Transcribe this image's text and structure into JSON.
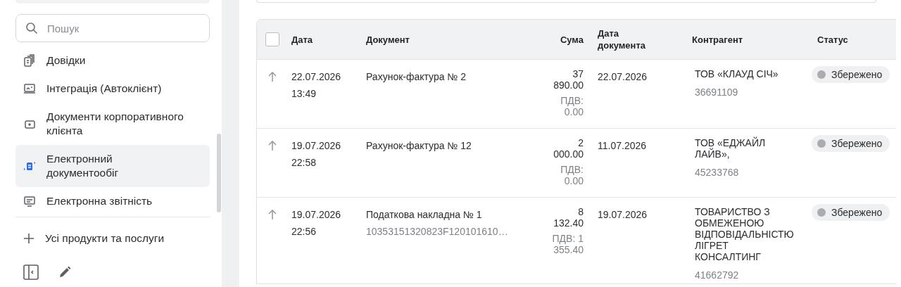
{
  "sidebar": {
    "search": {
      "placeholder": "Пошук"
    },
    "items": [
      {
        "label": "Довідки",
        "selected": false
      },
      {
        "label": "Інтеграція (Автоклієнт)",
        "selected": false
      },
      {
        "label": "Документи корпоративного клієнта",
        "selected": false
      },
      {
        "label": "Електронний документообіг",
        "selected": true
      },
      {
        "label": "Електронна звітність",
        "selected": false
      }
    ],
    "all_products": "Усі продукти та послуги"
  },
  "table": {
    "select_all": {
      "checked": false
    },
    "columns": [
      "Дата",
      "Документ",
      "Сума",
      "Дата документа",
      "Контрагент",
      "Статус"
    ],
    "rows": [
      {
        "date": "22.07.2026",
        "time": "13:49",
        "document": "Рахунок-фактура № 2",
        "amount": "37 890.00",
        "vat": "ПДВ: 0.00",
        "doc_date": "22.07.2026",
        "counterparty": "ТОВ «КЛАУД СІЧ»",
        "code": "36691109",
        "status": "Збережено"
      },
      {
        "date": "19.07.2026",
        "time": "22:58",
        "document": "Рахунок-фактура № 12",
        "amount": "2 000.00",
        "vat": "ПДВ: 0.00",
        "doc_date": "11.07.2026",
        "counterparty": "ТОВ «ЕДЖАЙЛ ЛАЙВ»,",
        "code": "45233768",
        "status": "Збережено"
      },
      {
        "date": "19.07.2026",
        "time": "22:56",
        "document": "Податкова накладна № 1",
        "doc_number": "10353151320823F120101610…",
        "amount": "8 132.40",
        "vat": "ПДВ: 1 355.40",
        "doc_date": "19.07.2026",
        "counterparty": "ТОВАРИСТВО З ОБМЕЖЕНОЮ ВІДПОВІДАЛЬНІСТЮ ЛІГРЕТ КОНСАЛТИНГ",
        "code": "41662792",
        "status": "Збережено"
      }
    ]
  }
}
